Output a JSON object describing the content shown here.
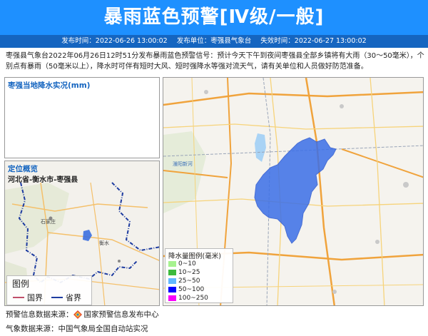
{
  "header": {
    "title": "暴雨蓝色预警[Ⅳ级/一般]",
    "issue_time": "发布时间：2022-06-26 13:00:02",
    "issuer": "发布单位：枣强县气象台",
    "expire_time": "失效时间：2022-06-27 13:00:02"
  },
  "description": "枣强县气象台2022年06月26日12时51分发布暴雨蓝色预警信号：预计今天下午到夜间枣强县全部乡镇将有大雨（30～50毫米），个别点有暴雨（50毫米以上），降水时可伴有短时大风、短时强降水等强对流天气，请有关单位和人员做好防范准备。",
  "live_panel": {
    "title": "枣强当地降水实况(mm)"
  },
  "locate_panel": {
    "title": "定位概览",
    "location": "河北省-衡水市-枣强县",
    "map_labels": [
      "石家庄",
      "衡水"
    ],
    "legend": {
      "title": "图例",
      "items": [
        {
          "label": "国界",
          "color": "#c0506a"
        },
        {
          "label": "省界",
          "color": "#1e3ca0"
        }
      ]
    }
  },
  "map": {
    "labels": [
      "滏阳新河"
    ],
    "rain_legend": {
      "title": "降水量图例(毫米)",
      "items": [
        {
          "label": "0~10",
          "color": "#a6f28f"
        },
        {
          "label": "10~25",
          "color": "#3dba3d"
        },
        {
          "label": "25~50",
          "color": "#61b8ff"
        },
        {
          "label": "50~100",
          "color": "#0000ff"
        },
        {
          "label": "100~250",
          "color": "#fa00fa"
        }
      ]
    }
  },
  "footer": {
    "warning_source_label": "预警信息数据来源：",
    "warning_source": "国家预警信息发布中心",
    "obs_source": "气象数据来源：中国气象局全国自动站实况"
  }
}
